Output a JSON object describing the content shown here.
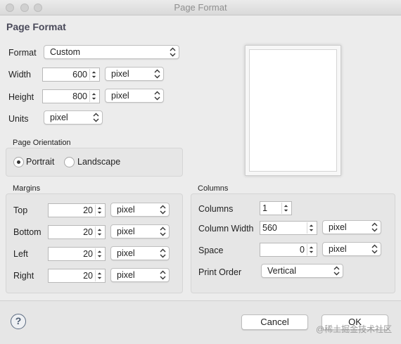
{
  "window": {
    "title": "Page Format"
  },
  "header": {
    "title": "Page Format"
  },
  "format": {
    "label": "Format",
    "value": "Custom"
  },
  "width": {
    "label": "Width",
    "value": "600",
    "unit": "pixel"
  },
  "height": {
    "label": "Height",
    "value": "800",
    "unit": "pixel"
  },
  "units": {
    "label": "Units",
    "value": "pixel"
  },
  "orientation": {
    "title": "Page Orientation",
    "portrait_label": "Portrait",
    "landscape_label": "Landscape",
    "selected": "Portrait"
  },
  "margins": {
    "title": "Margins",
    "rows": [
      {
        "label": "Top",
        "value": "20",
        "unit": "pixel"
      },
      {
        "label": "Bottom",
        "value": "20",
        "unit": "pixel"
      },
      {
        "label": "Left",
        "value": "20",
        "unit": "pixel"
      },
      {
        "label": "Right",
        "value": "20",
        "unit": "pixel"
      }
    ]
  },
  "columns": {
    "title": "Columns",
    "columns_label": "Columns",
    "columns_value": "1",
    "width_label": "Column Width",
    "width_value": "560",
    "width_unit": "pixel",
    "space_label": "Space",
    "space_value": "0",
    "space_unit": "pixel",
    "order_label": "Print Order",
    "order_value": "Vertical"
  },
  "buttons": {
    "cancel": "Cancel",
    "ok": "OK",
    "help": "?"
  },
  "watermark": "@稀土掘金技术社区",
  "icons": [
    "close-dot-icon",
    "minimize-dot-icon",
    "zoom-dot-icon",
    "updown-chevron-icon",
    "stepper-icon",
    "help-icon"
  ],
  "colors": {
    "header_text": "#4a4a5a",
    "panel_bg": "#e6e6e6",
    "window_bg": "#ececec"
  }
}
